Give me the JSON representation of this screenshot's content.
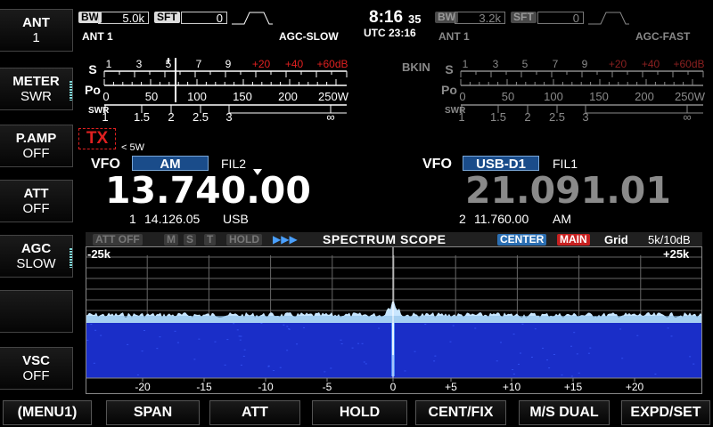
{
  "side_keys": [
    {
      "title": "ANT",
      "value": "1"
    },
    {
      "title": "METER",
      "value": "SWR"
    },
    {
      "title": "P.AMP",
      "value": "OFF"
    },
    {
      "title": "ATT",
      "value": "OFF"
    },
    {
      "title": "AGC",
      "value": "SLOW"
    },
    {
      "title": "",
      "value": ""
    },
    {
      "title": "VSC",
      "value": "OFF"
    }
  ],
  "bottom_keys": [
    "(MENU1)",
    "SPAN",
    "ATT",
    "HOLD",
    "CENT/FIX",
    "M/S DUAL",
    "EXPD/SET"
  ],
  "clock": {
    "time": "8:16",
    "seconds": "35",
    "utc": "UTC 23:16"
  },
  "main": {
    "bw_label": "BW",
    "bw": "5.0k",
    "sft_label": "SFT",
    "sft": "0",
    "ant": "ANT 1",
    "agc": "AGC-SLOW",
    "meter": {
      "s_label": "S",
      "po_label": "Po",
      "swr_label": "SWR",
      "s_scale": [
        "1",
        "3",
        "5",
        "7",
        "9",
        "+20",
        "+40",
        "+60dB"
      ],
      "po_scale": [
        "0",
        "50",
        "100",
        "150",
        "200",
        "250W"
      ],
      "swr_scale": [
        "1",
        "1.5",
        "2",
        "2.5",
        "3",
        "∞"
      ]
    },
    "tx": "TX",
    "tx_power": "< 5W",
    "vfo_label": "VFO",
    "mode": "AM",
    "filter": "FIL2",
    "freq": "13.740.00",
    "sub_num": "1",
    "sub_freq": "14.126.05",
    "sub_mode": "USB"
  },
  "sub": {
    "bw_label": "BW",
    "bw": "3.2k",
    "sft_label": "SFT",
    "sft": "0",
    "ant": "ANT 1",
    "agc": "AGC-FAST",
    "bkin": "BKIN",
    "vfo_label": "VFO",
    "mode": "USB-D1",
    "filter": "FIL1",
    "freq": "21.091.01",
    "sub_num": "2",
    "sub_freq": "11.760.00",
    "sub_mode": "AM"
  },
  "scope": {
    "att_off": "ATT OFF",
    "m": "M",
    "s": "S",
    "t": "T",
    "hold": "HOLD",
    "title": "SPECTRUM SCOPE",
    "center": "CENTER",
    "main": "MAIN",
    "grid": "Grid",
    "span": "5k/10dB",
    "left_edge": "-25k",
    "right_edge": "+25k",
    "x_ticks": [
      "-20",
      "-15",
      "-10",
      "-5",
      "0",
      "+5",
      "+10",
      "+15",
      "+20"
    ]
  },
  "colors": {
    "accent_red": "#e02020",
    "mode_blue": "#1a4c8a",
    "waterfall": "#1a2ec8",
    "center_chip": "#2b6fb3",
    "main_chip": "#c82020"
  }
}
